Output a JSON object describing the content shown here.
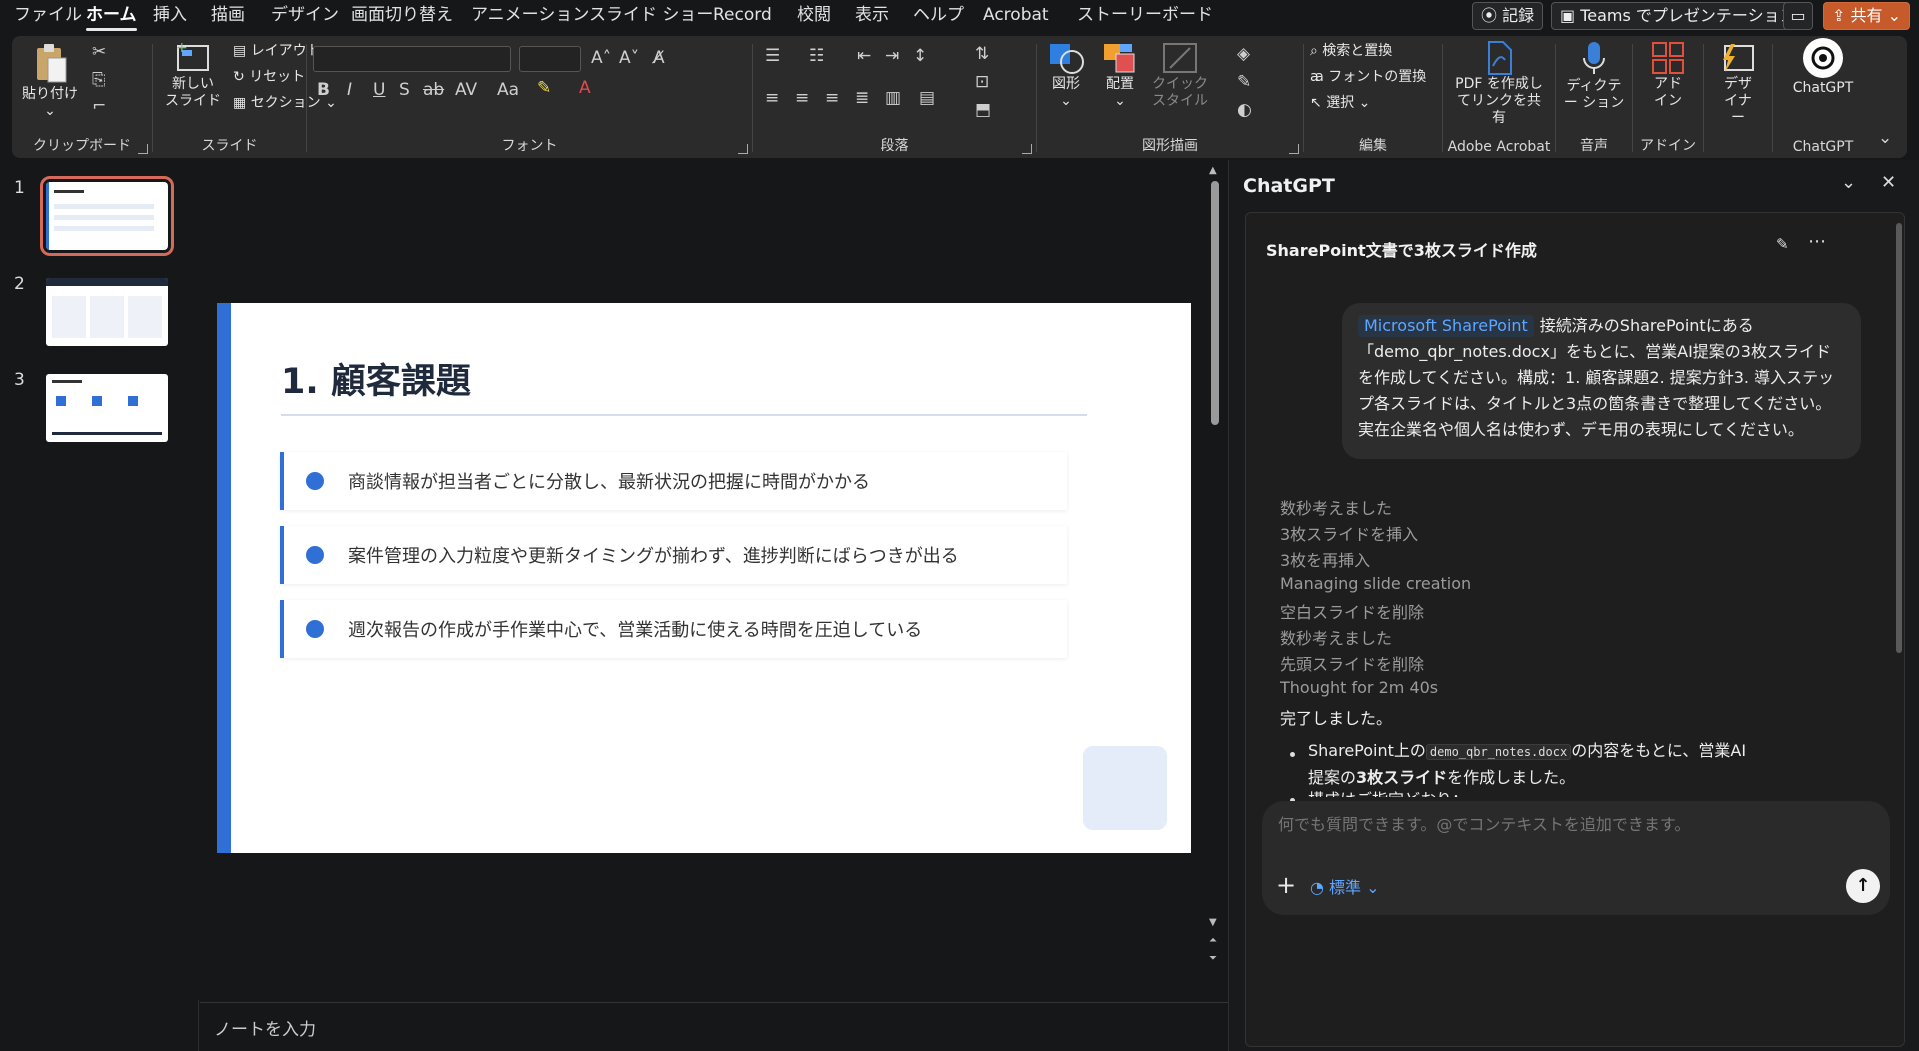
{
  "menu": {
    "items": [
      "ファイル",
      "ホーム",
      "挿入",
      "描画",
      "デザイン",
      "画面切り替え",
      "アニメーション",
      "スライド ショー",
      "Record",
      "校閲",
      "表示",
      "ヘルプ",
      "Acrobat",
      "ストーリーボード"
    ],
    "active": "ホーム"
  },
  "topbar": {
    "record": "記録",
    "teams": "Teams でプレゼンテーション",
    "share": "共有"
  },
  "ribbon": {
    "clipboard": {
      "paste": "貼り付け",
      "label": "クリップボード"
    },
    "slides": {
      "new_slide": "新しい スライド",
      "layout": "レイアウト",
      "reset": "リセット",
      "section": "セクション",
      "label": "スライド"
    },
    "font": {
      "label": "フォント"
    },
    "paragraph": {
      "label": "段落"
    },
    "drawing": {
      "shapes": "図形",
      "arrange": "配置",
      "quick_style": "クイック スタイル",
      "label": "図形描画"
    },
    "editing": {
      "find_replace": "検索と置換",
      "replace_font": "フォントの置換",
      "select": "選択",
      "label": "編集"
    },
    "acrobat": {
      "create_pdf": "PDF を作成し てリンクを共有",
      "label": "Adobe Acrobat"
    },
    "voice": {
      "dictate": "ディクテー ション",
      "label": "音声"
    },
    "addins": {
      "addins": "アド イン",
      "label": "アドイン"
    },
    "designer": {
      "designer": "デザ イナー"
    },
    "chatgpt": {
      "chatgpt": "ChatGPT",
      "label": "ChatGPT"
    }
  },
  "thumbnails": [
    "1",
    "2",
    "3"
  ],
  "slide": {
    "title": "1. 顧客課題",
    "bullets": [
      "商談情報が担当者ごとに分散し、最新状況の把握に時間がかかる",
      "案件管理の入力粒度や更新タイミングが揃わず、進捗判断にばらつきが出る",
      "週次報告の作成が手作業中心で、営業活動に使える時間を圧迫している"
    ]
  },
  "notes": {
    "placeholder": "ノートを入力"
  },
  "pane": {
    "title": "ChatGPT",
    "chat_title": "SharePoint文書で3枚スライド作成",
    "user_chip": "Microsoft SharePoint",
    "user_message": "接続済みのSharePointにある「demo_qbr_notes.docx」をもとに、営業AI提案の3枚スライドを作成してください。構成：1. 顧客課題2. 提案方針3. 導入ステップ各スライドは、タイトルと3点の箇条書きで整理してください。実在企業名や個人名は使わず、デモ用の表現にしてください。",
    "steps": [
      "数秒考えました",
      "3枚スライドを挿入",
      "3枚を再挿入",
      "Managing slide creation",
      "空白スライドを削除",
      "数秒考えました",
      "先頭スライドを削除",
      "Thought for 2m 40s"
    ],
    "done": "完了しました。",
    "result_pre": "SharePoint上の",
    "result_code": "demo_qbr_notes.docx",
    "result_mid": "の内容をもとに、営業AI提案の",
    "result_bold": "3枚スライド",
    "result_post": "を作成しました。",
    "result_cut": "構成はご指定どおり：",
    "composer_placeholder": "何でも質問できます。@でコンテキストを追加できます。",
    "mode": "標準"
  }
}
